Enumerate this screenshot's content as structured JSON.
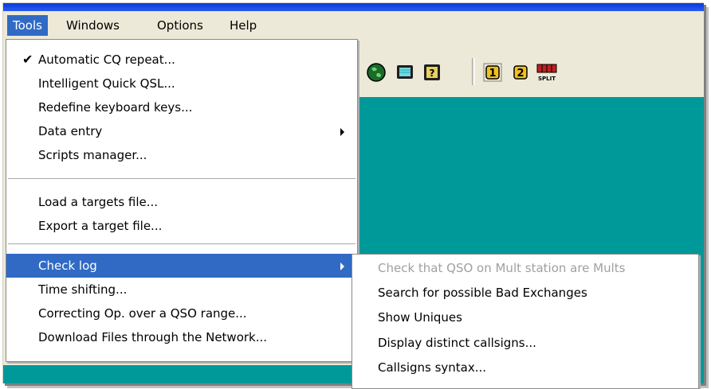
{
  "menubar": {
    "items": [
      {
        "label": "Tools",
        "active": true
      },
      {
        "label": "Windows"
      },
      {
        "label": "Options"
      },
      {
        "label": "Help"
      }
    ]
  },
  "toolbar": {
    "buttons": [
      {
        "icon": "globe-icon"
      },
      {
        "icon": "monitor-icon"
      },
      {
        "icon": "question-map-icon"
      },
      {
        "icon": "vfo-1-icon",
        "label": "1"
      },
      {
        "icon": "vfo-2-icon",
        "label": "2"
      },
      {
        "icon": "split-icon",
        "label": "SPLIT"
      }
    ]
  },
  "tools_menu": {
    "items": [
      {
        "label": "Automatic CQ repeat...",
        "checked": true,
        "check_glyph": "✔"
      },
      {
        "label": "Intelligent Quick QSL..."
      },
      {
        "label": "Redefine keyboard keys..."
      },
      {
        "label": "Data entry",
        "submenu": true
      },
      {
        "label": "Scripts manager..."
      },
      {
        "label": "Load a targets file..."
      },
      {
        "label": "Export a target file..."
      },
      {
        "label": "Check log",
        "submenu": true,
        "highlighted": true
      },
      {
        "label": "Time shifting..."
      },
      {
        "label": "Correcting Op. over a QSO range..."
      },
      {
        "label": "Download Files through the Network..."
      }
    ]
  },
  "check_log_submenu": {
    "items": [
      {
        "label": "Check that QSO on Mult station are Mults",
        "disabled": true
      },
      {
        "label": "Search for possible Bad Exchanges"
      },
      {
        "label": "Show Uniques"
      },
      {
        "label": "Display distinct callsigns..."
      },
      {
        "label": "Callsigns syntax..."
      }
    ]
  },
  "colors": {
    "menu_highlight": "#316ac5",
    "workspace_teal": "#009999",
    "chrome": "#ece9d8",
    "titlebar_blue": "#0a3ad8"
  }
}
